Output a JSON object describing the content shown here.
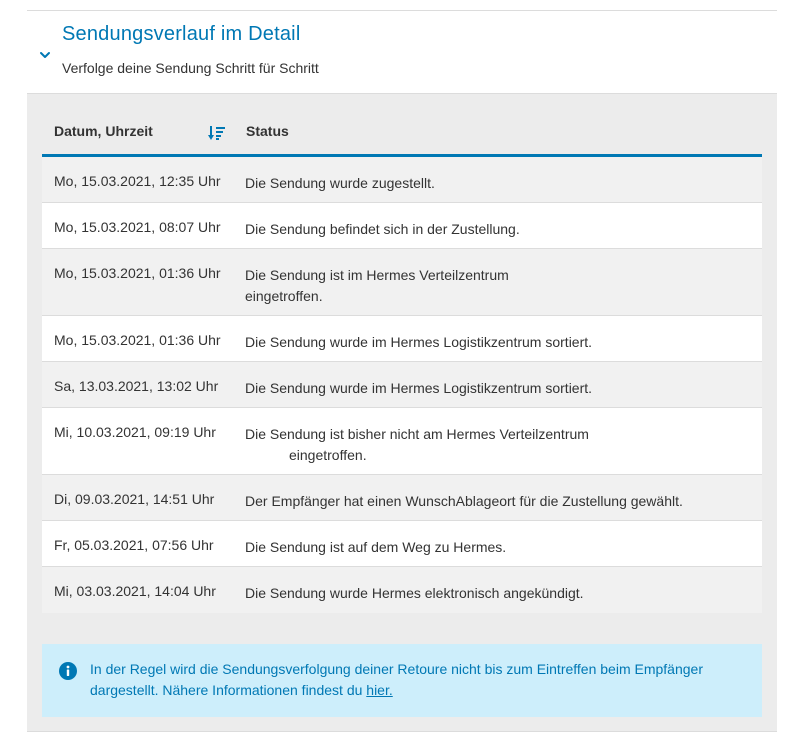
{
  "accordion": {
    "title": "Sendungsverlauf im Detail",
    "subtitle": "Verfolge deine Sendung Schritt für Schritt",
    "chevron_icon": "chevron-down-icon"
  },
  "table": {
    "columns": {
      "date": "Datum, Uhrzeit",
      "status": "Status"
    },
    "sort_icon": "sort-descending-icon",
    "rows": [
      {
        "date": "Mo, 15.03.2021, 12:35 Uhr",
        "status": "Die Sendung wurde zugestellt."
      },
      {
        "date": "Mo, 15.03.2021, 08:07 Uhr",
        "status": "Die Sendung befindet sich in der Zustellung."
      },
      {
        "date": "Mo, 15.03.2021, 01:36 Uhr",
        "status_line1": "Die Sendung ist im Hermes Verteilzentrum",
        "status_line2": "eingetroffen."
      },
      {
        "date": "Mo, 15.03.2021, 01:36 Uhr",
        "status": "Die Sendung wurde im Hermes Logistikzentrum sortiert."
      },
      {
        "date": "Sa, 13.03.2021, 13:02 Uhr",
        "status": "Die Sendung wurde im Hermes Logistikzentrum sortiert."
      },
      {
        "date": "Mi, 10.03.2021, 09:19 Uhr",
        "status_line1": "Die Sendung ist bisher nicht am Hermes Verteilzentrum",
        "status_line2": "eingetroffen."
      },
      {
        "date": "Di, 09.03.2021, 14:51 Uhr",
        "status": "Der Empfänger hat einen WunschAblageort für die Zustellung gewählt."
      },
      {
        "date": "Fr, 05.03.2021, 07:56 Uhr",
        "status": "Die Sendung ist auf dem Weg zu Hermes."
      },
      {
        "date": "Mi, 03.03.2021, 14:04 Uhr",
        "status": "Die Sendung wurde Hermes elektronisch angekündigt."
      }
    ]
  },
  "info": {
    "icon": "info-icon",
    "text_line1": "In der Regel wird die Sendungsverfolgung deiner Retoure nicht bis zum Eintreffen beim Empfänger",
    "text_line2": "dargestellt. Nähere Informationen findest du",
    "link": "hier."
  },
  "colors": {
    "accent": "#0078b4",
    "info_bg": "#cdeefb",
    "panel_bg": "#ececec"
  }
}
